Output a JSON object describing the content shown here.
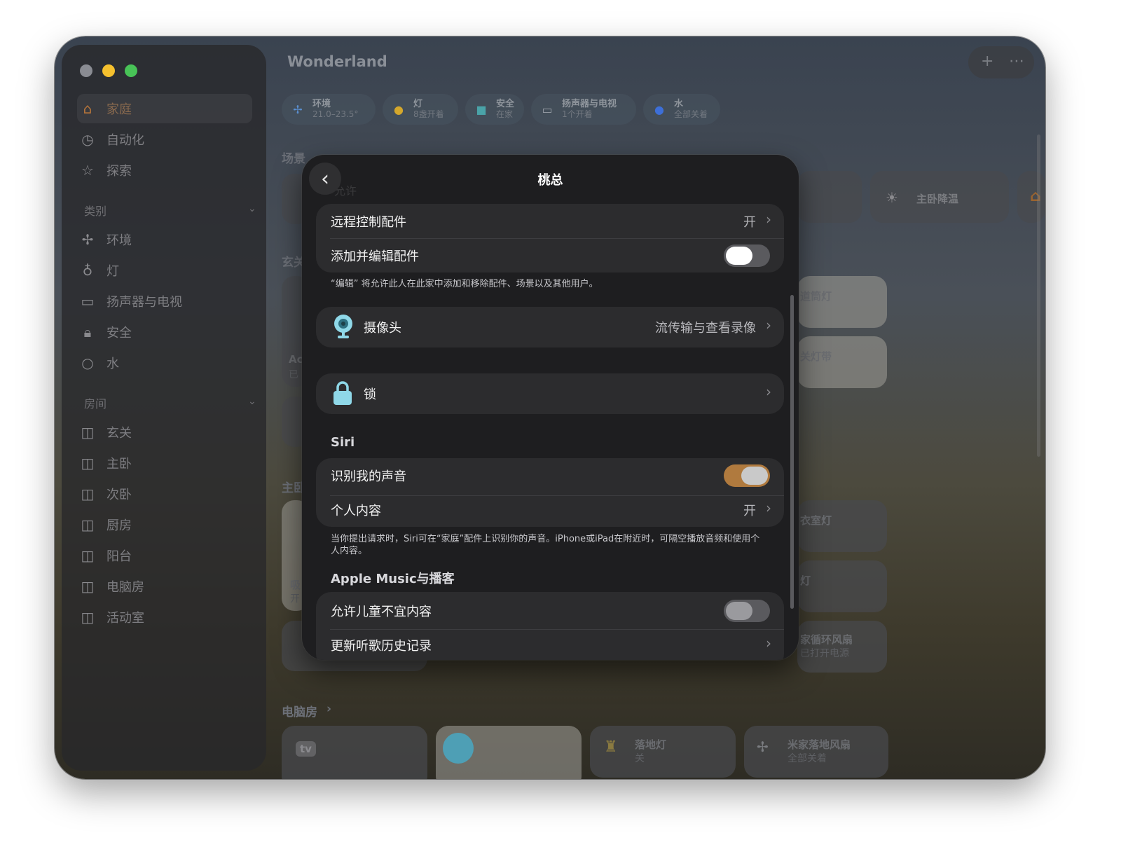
{
  "window": {
    "title": "Wonderland"
  },
  "sidebar": {
    "nav": [
      {
        "label": "家庭",
        "icon": "house-icon"
      },
      {
        "label": "自动化",
        "icon": "clock-check-icon"
      },
      {
        "label": "探索",
        "icon": "star-icon"
      }
    ],
    "categories_header": "类别",
    "categories": [
      {
        "label": "环境",
        "icon": "fan-icon"
      },
      {
        "label": "灯",
        "icon": "lightbulb-icon"
      },
      {
        "label": "扬声器与电视",
        "icon": "tv-speaker-icon"
      },
      {
        "label": "安全",
        "icon": "lock-icon"
      },
      {
        "label": "水",
        "icon": "drop-icon"
      }
    ],
    "rooms_header": "房间",
    "rooms": [
      {
        "label": "玄关"
      },
      {
        "label": "主卧"
      },
      {
        "label": "次卧"
      },
      {
        "label": "厨房"
      },
      {
        "label": "阳台"
      },
      {
        "label": "电脑房"
      },
      {
        "label": "活动室"
      }
    ]
  },
  "status_pills": [
    {
      "title": "环境",
      "sub": "21.0–23.5°",
      "icon": "fan-icon",
      "color": "#5a8fd0"
    },
    {
      "title": "灯",
      "sub": "8盏开着",
      "icon": "lightbulb-icon",
      "color": "#d4a72c"
    },
    {
      "title": "安全",
      "sub": "在家",
      "icon": "lock-icon",
      "color": "#4aa3a8"
    },
    {
      "title": "扬声器与电视",
      "sub": "1个开着",
      "icon": "tv-speaker-icon",
      "color": "#9aa0a8"
    },
    {
      "title": "水",
      "sub": "全部关着",
      "icon": "drop-icon",
      "color": "#3d6fd8"
    }
  ],
  "background": {
    "scenes_label": "场景",
    "scene_tile": "主卧降温",
    "entry_label": "玄关",
    "tile_corridor_light": "道筒灯",
    "tile_light_strip": "关灯带",
    "master_label": "主卧",
    "tile_closet_light": "衣室灯",
    "tile_light": "灯",
    "tile_fan": "家循环风扇",
    "tile_fan_sub": "已打开电源",
    "tile_vac_a": "吸",
    "tile_vac_b": "开",
    "tile_ac_a": "Ac",
    "tile_ac_b": "已",
    "computer_room_label": "电脑房",
    "tile_appletv": "tv",
    "tile_floor_lamp": "落地灯",
    "tile_floor_lamp_sub": "关",
    "tile_floor_fan": "米家落地风扇",
    "tile_floor_fan_sub": "全部关着"
  },
  "modal": {
    "title": "桃总",
    "ghost_text": "允许",
    "rows": {
      "remote_control": {
        "label": "远程控制配件",
        "value": "开"
      },
      "add_edit": {
        "label": "添加并编辑配件",
        "toggle": false
      }
    },
    "edit_note": "“编辑” 将允许此人在此家中添加和移除配件、场景以及其他用户。",
    "camera": {
      "label": "摄像头",
      "value": "流传输与查看录像",
      "icon": "camera-icon"
    },
    "lock": {
      "label": "锁",
      "icon": "lock-icon"
    },
    "siri_header": "Siri",
    "recognize_voice": {
      "label": "识别我的声音",
      "toggle": true
    },
    "personal_content": {
      "label": "个人内容",
      "value": "开"
    },
    "siri_note": "当你提出请求时，Siri可在“家庭”配件上识别你的声音。iPhone或iPad在附近时，可隔空播放音频和使用个人内容。",
    "music_header": "Apple Music与播客",
    "explicit_content": {
      "label": "允许儿童不宜内容",
      "toggle": false
    },
    "update_history": {
      "label": "更新听歌历史记录"
    }
  }
}
